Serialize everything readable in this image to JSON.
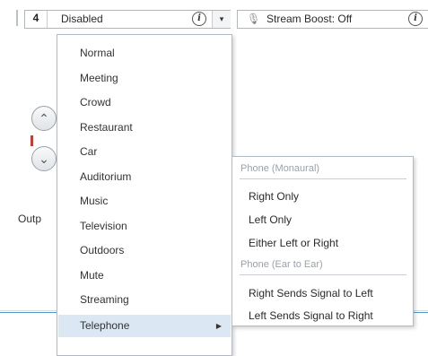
{
  "toolbar": {
    "program_number": "4",
    "program_name": "Disabled",
    "info_glyph": "i",
    "dropdown_glyph": "▾",
    "boost_icon": "🎙",
    "boost_label": "Stream Boost: Off"
  },
  "background": {
    "up_glyph": "⌃",
    "down_glyph": "⌄",
    "output_label_partial": "Outp"
  },
  "menu": {
    "items": [
      {
        "label": "Normal"
      },
      {
        "label": "Meeting"
      },
      {
        "label": "Crowd"
      },
      {
        "label": "Restaurant"
      },
      {
        "label": "Car"
      },
      {
        "label": "Auditorium"
      },
      {
        "label": "Music"
      },
      {
        "label": "Television"
      },
      {
        "label": "Outdoors"
      },
      {
        "label": "Mute"
      },
      {
        "label": "Streaming"
      },
      {
        "label": "Telephone",
        "has_submenu": true,
        "highlighted": true
      }
    ],
    "submenu_arrow": "▶"
  },
  "submenu": {
    "group1_header": "Phone (Monaural)",
    "group1_items": [
      "Right Only",
      "Left Only",
      "Either Left or Right"
    ],
    "group2_header": "Phone (Ear to Ear)",
    "group2_items": [
      "Right Sends Signal to Left",
      "Left Sends Signal to Right"
    ]
  },
  "colors": {
    "highlight": "#dbe7f3",
    "accent_line": "#4f9bc7",
    "indicator_red": "#d9362b"
  }
}
